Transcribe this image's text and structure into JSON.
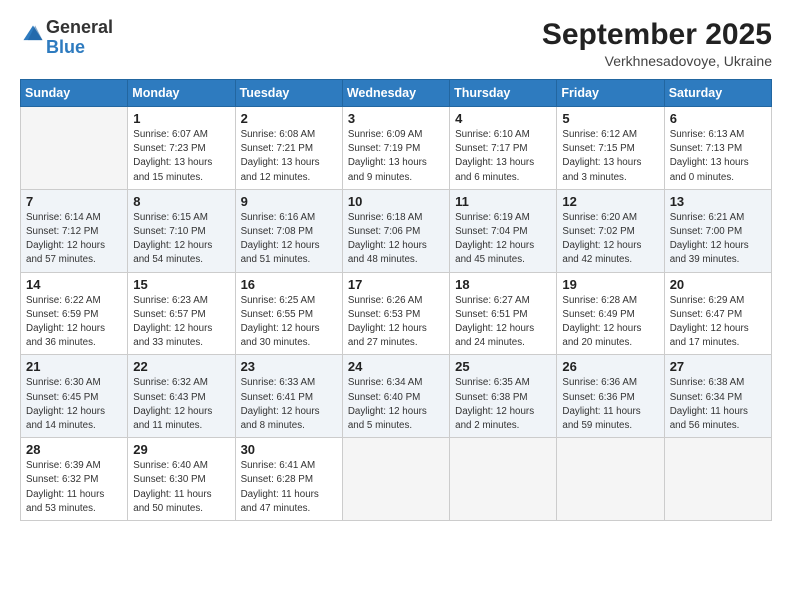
{
  "logo": {
    "general": "General",
    "blue": "Blue"
  },
  "header": {
    "month": "September 2025",
    "location": "Verkhnesadovoye, Ukraine"
  },
  "weekdays": [
    "Sunday",
    "Monday",
    "Tuesday",
    "Wednesday",
    "Thursday",
    "Friday",
    "Saturday"
  ],
  "weeks": [
    [
      {
        "day": "",
        "info": ""
      },
      {
        "day": "1",
        "info": "Sunrise: 6:07 AM\nSunset: 7:23 PM\nDaylight: 13 hours\nand 15 minutes."
      },
      {
        "day": "2",
        "info": "Sunrise: 6:08 AM\nSunset: 7:21 PM\nDaylight: 13 hours\nand 12 minutes."
      },
      {
        "day": "3",
        "info": "Sunrise: 6:09 AM\nSunset: 7:19 PM\nDaylight: 13 hours\nand 9 minutes."
      },
      {
        "day": "4",
        "info": "Sunrise: 6:10 AM\nSunset: 7:17 PM\nDaylight: 13 hours\nand 6 minutes."
      },
      {
        "day": "5",
        "info": "Sunrise: 6:12 AM\nSunset: 7:15 PM\nDaylight: 13 hours\nand 3 minutes."
      },
      {
        "day": "6",
        "info": "Sunrise: 6:13 AM\nSunset: 7:13 PM\nDaylight: 13 hours\nand 0 minutes."
      }
    ],
    [
      {
        "day": "7",
        "info": "Sunrise: 6:14 AM\nSunset: 7:12 PM\nDaylight: 12 hours\nand 57 minutes."
      },
      {
        "day": "8",
        "info": "Sunrise: 6:15 AM\nSunset: 7:10 PM\nDaylight: 12 hours\nand 54 minutes."
      },
      {
        "day": "9",
        "info": "Sunrise: 6:16 AM\nSunset: 7:08 PM\nDaylight: 12 hours\nand 51 minutes."
      },
      {
        "day": "10",
        "info": "Sunrise: 6:18 AM\nSunset: 7:06 PM\nDaylight: 12 hours\nand 48 minutes."
      },
      {
        "day": "11",
        "info": "Sunrise: 6:19 AM\nSunset: 7:04 PM\nDaylight: 12 hours\nand 45 minutes."
      },
      {
        "day": "12",
        "info": "Sunrise: 6:20 AM\nSunset: 7:02 PM\nDaylight: 12 hours\nand 42 minutes."
      },
      {
        "day": "13",
        "info": "Sunrise: 6:21 AM\nSunset: 7:00 PM\nDaylight: 12 hours\nand 39 minutes."
      }
    ],
    [
      {
        "day": "14",
        "info": "Sunrise: 6:22 AM\nSunset: 6:59 PM\nDaylight: 12 hours\nand 36 minutes."
      },
      {
        "day": "15",
        "info": "Sunrise: 6:23 AM\nSunset: 6:57 PM\nDaylight: 12 hours\nand 33 minutes."
      },
      {
        "day": "16",
        "info": "Sunrise: 6:25 AM\nSunset: 6:55 PM\nDaylight: 12 hours\nand 30 minutes."
      },
      {
        "day": "17",
        "info": "Sunrise: 6:26 AM\nSunset: 6:53 PM\nDaylight: 12 hours\nand 27 minutes."
      },
      {
        "day": "18",
        "info": "Sunrise: 6:27 AM\nSunset: 6:51 PM\nDaylight: 12 hours\nand 24 minutes."
      },
      {
        "day": "19",
        "info": "Sunrise: 6:28 AM\nSunset: 6:49 PM\nDaylight: 12 hours\nand 20 minutes."
      },
      {
        "day": "20",
        "info": "Sunrise: 6:29 AM\nSunset: 6:47 PM\nDaylight: 12 hours\nand 17 minutes."
      }
    ],
    [
      {
        "day": "21",
        "info": "Sunrise: 6:30 AM\nSunset: 6:45 PM\nDaylight: 12 hours\nand 14 minutes."
      },
      {
        "day": "22",
        "info": "Sunrise: 6:32 AM\nSunset: 6:43 PM\nDaylight: 12 hours\nand 11 minutes."
      },
      {
        "day": "23",
        "info": "Sunrise: 6:33 AM\nSunset: 6:41 PM\nDaylight: 12 hours\nand 8 minutes."
      },
      {
        "day": "24",
        "info": "Sunrise: 6:34 AM\nSunset: 6:40 PM\nDaylight: 12 hours\nand 5 minutes."
      },
      {
        "day": "25",
        "info": "Sunrise: 6:35 AM\nSunset: 6:38 PM\nDaylight: 12 hours\nand 2 minutes."
      },
      {
        "day": "26",
        "info": "Sunrise: 6:36 AM\nSunset: 6:36 PM\nDaylight: 11 hours\nand 59 minutes."
      },
      {
        "day": "27",
        "info": "Sunrise: 6:38 AM\nSunset: 6:34 PM\nDaylight: 11 hours\nand 56 minutes."
      }
    ],
    [
      {
        "day": "28",
        "info": "Sunrise: 6:39 AM\nSunset: 6:32 PM\nDaylight: 11 hours\nand 53 minutes."
      },
      {
        "day": "29",
        "info": "Sunrise: 6:40 AM\nSunset: 6:30 PM\nDaylight: 11 hours\nand 50 minutes."
      },
      {
        "day": "30",
        "info": "Sunrise: 6:41 AM\nSunset: 6:28 PM\nDaylight: 11 hours\nand 47 minutes."
      },
      {
        "day": "",
        "info": ""
      },
      {
        "day": "",
        "info": ""
      },
      {
        "day": "",
        "info": ""
      },
      {
        "day": "",
        "info": ""
      }
    ]
  ]
}
